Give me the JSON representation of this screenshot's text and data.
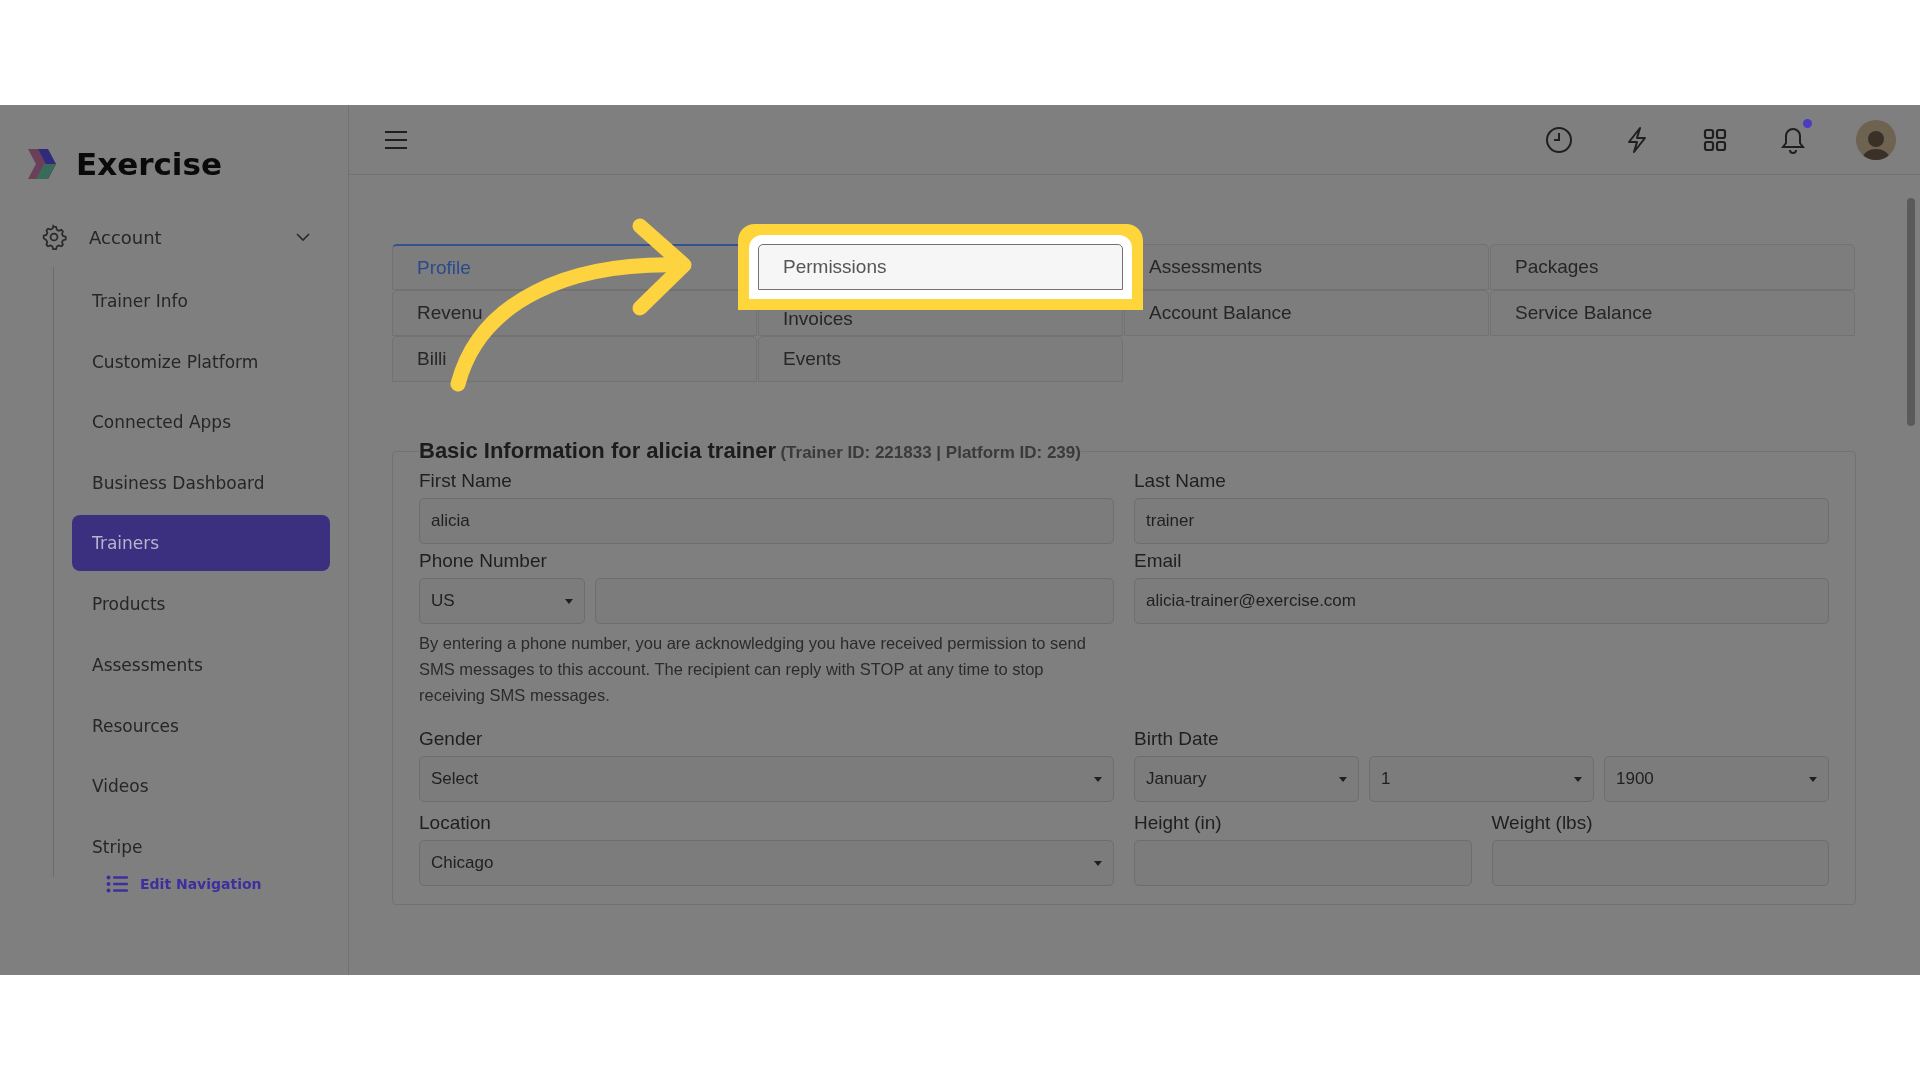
{
  "app": {
    "logo": "Exercise"
  },
  "sidebar": {
    "section": {
      "label": "Account",
      "expanded": true
    },
    "items": [
      {
        "label": "Trainer Info",
        "selected": false
      },
      {
        "label": "Customize Platform",
        "selected": false
      },
      {
        "label": "Connected Apps",
        "selected": false
      },
      {
        "label": "Business Dashboard",
        "selected": false
      },
      {
        "label": "Trainers",
        "selected": true
      },
      {
        "label": "Products",
        "selected": false
      },
      {
        "label": "Assessments",
        "selected": false
      },
      {
        "label": "Resources",
        "selected": false
      },
      {
        "label": "Videos",
        "selected": false
      },
      {
        "label": "Stripe",
        "selected": false
      }
    ],
    "edit_link": "Edit Navigation"
  },
  "topbar": {
    "notification_unread": true
  },
  "tabs": [
    {
      "label": "Profile",
      "selected": true,
      "highlighted": false
    },
    {
      "label": "Permissions",
      "selected": false,
      "highlighted": true
    },
    {
      "label": "Assessments",
      "selected": false,
      "highlighted": false
    },
    {
      "label": "Packages",
      "selected": false,
      "highlighted": false
    },
    {
      "label": "Revenu",
      "selected": false,
      "highlighted": false
    },
    {
      "label": "Invoices",
      "selected": false,
      "highlighted": false
    },
    {
      "label": "Account Balance",
      "selected": false,
      "highlighted": false
    },
    {
      "label": "Service Balance",
      "selected": false,
      "highlighted": false
    },
    {
      "label": "Billi",
      "selected": false,
      "highlighted": false
    },
    {
      "label": "Events",
      "selected": false,
      "highlighted": false
    }
  ],
  "form": {
    "title": "Basic Information for alicia trainer",
    "subtitle": "(Trainer ID: 221833 | Platform ID: 239)",
    "first_name": {
      "label": "First Name",
      "value": "alicia"
    },
    "last_name": {
      "label": "Last Name",
      "value": "trainer"
    },
    "phone": {
      "label": "Phone Number",
      "country": "US"
    },
    "phone_notice": "By entering a phone number, you are acknowledging you have received permission to send SMS messages to this account. The recipient can reply with STOP at any time to stop receiving SMS messages.",
    "email": {
      "label": "Email",
      "value": "alicia-trainer@exercise.com"
    },
    "gender": {
      "label": "Gender",
      "value": "Select"
    },
    "birth_date": {
      "label": "Birth Date",
      "month": "January",
      "day": "1",
      "year": "1900"
    },
    "location": {
      "label": "Location",
      "value": "Chicago"
    },
    "height": {
      "label": "Height (in)"
    },
    "weight": {
      "label": "Weight (lbs)"
    }
  }
}
